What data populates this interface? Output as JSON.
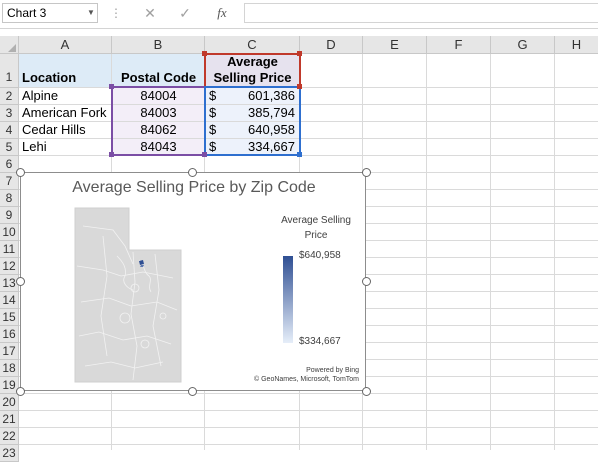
{
  "formula_bar": {
    "name_box": "Chart 3",
    "cancel_icon": "✕",
    "enter_icon": "✓",
    "function_icon": "fx",
    "formula": ""
  },
  "columns": [
    "A",
    "B",
    "C",
    "D",
    "E",
    "F",
    "G",
    "H"
  ],
  "rows": [
    "1",
    "2",
    "3",
    "4",
    "5",
    "6",
    "7",
    "8",
    "9",
    "10",
    "11",
    "12",
    "13",
    "14",
    "15",
    "16",
    "17",
    "18",
    "19",
    "20",
    "21",
    "22",
    "23"
  ],
  "table": {
    "headers": {
      "location": "Location",
      "postal": "Postal Code",
      "price_line1": "Average",
      "price_line2": "Selling Price"
    },
    "rows": [
      {
        "location": "Alpine",
        "postal": "84004",
        "currency": "$",
        "price": "601,386"
      },
      {
        "location": "American Fork",
        "postal": "84003",
        "currency": "$",
        "price": "385,794"
      },
      {
        "location": "Cedar Hills",
        "postal": "84062",
        "currency": "$",
        "price": "640,958"
      },
      {
        "location": "Lehi",
        "postal": "84043",
        "currency": "$",
        "price": "334,667"
      }
    ]
  },
  "chart": {
    "title": "Average Selling Price by Zip Code",
    "legend_title_line1": "Average Selling",
    "legend_title_line2": "Price",
    "legend_max": "$640,958",
    "legend_min": "$334,667",
    "credit_line1": "Powered by Bing",
    "credit_line2": "© GeoNames, Microsoft, TomTom"
  },
  "colors": {
    "header_fill": "#ddebf7",
    "selection_purple": "#7b4ea5",
    "selection_red": "#c0392b",
    "selection_blue": "#2e6fcf",
    "legend_dark": "#2f4f93",
    "legend_light": "#e6eef9"
  }
}
